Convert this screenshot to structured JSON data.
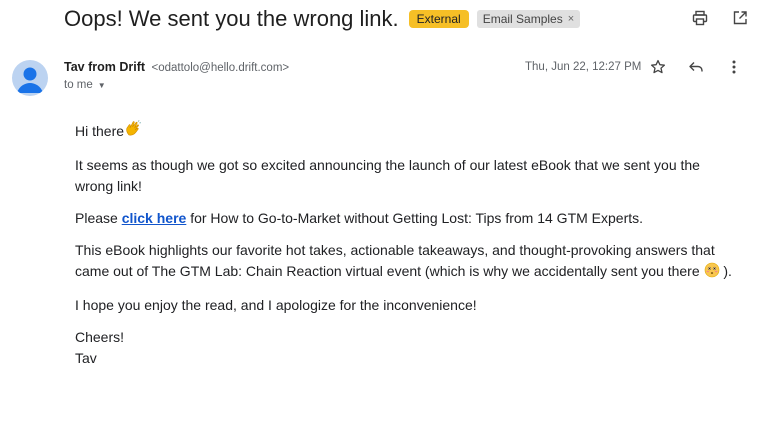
{
  "email": {
    "subject": "Oops! We sent you the wrong link.",
    "labels": {
      "external": "External",
      "folder": "Email Samples",
      "folder_remove": "×"
    },
    "sender": {
      "name": "Tav from Drift",
      "email": "<odattolo@hello.drift.com>",
      "recipient": "to me"
    },
    "date": "Thu, Jun 22, 12:27 PM",
    "body": {
      "greeting": "Hi there",
      "p1": "It seems as though we got so excited announcing the launch of our latest eBook that we sent you the wrong link!",
      "p2_pre": "Please ",
      "p2_link": "click here",
      "p2_post": " for How to Go-to-Market without Getting Lost: Tips from 14 GTM Experts.",
      "p3": "This eBook highlights our favorite hot takes, actionable takeaways, and thought-provoking answers that came out of The GTM Lab: Chain Reaction virtual event (which is why we accidentally sent you there",
      "p3_end": " ).",
      "p4": "I hope you enjoy the read, and I apologize for the inconvenience!",
      "signoff": "Cheers!",
      "signature": "Tav"
    }
  },
  "icons": {
    "print": "printer-icon",
    "popout": "open-in-new-window-icon",
    "star": "star-icon",
    "reply": "reply-icon",
    "more": "more-vertical-icon",
    "avatar": "person-avatar-icon",
    "wave": "waving-hand-emoji",
    "flushed": "flushed-face-emoji"
  },
  "colors": {
    "external_badge": "#f6bf26",
    "link": "#1155cc",
    "avatar_bg": "#bcd3f1",
    "avatar_fg": "#1a73e8"
  }
}
